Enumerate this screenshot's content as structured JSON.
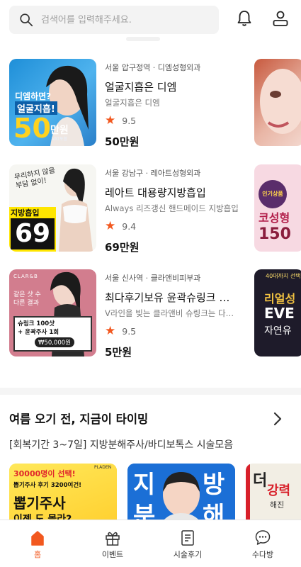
{
  "search": {
    "placeholder": "검색어를 입력해주세요."
  },
  "products": [
    {
      "location": "서울 압구정역 · 디엠성형외과",
      "title": "얼굴지흡은 디엠",
      "subtitle": "얼굴지흡은 디엠",
      "rating": "9.5",
      "price": "50만원",
      "thumb_text": {
        "line1": "디엠하면?",
        "line2": "얼굴지흡!",
        "big": "50",
        "unit": "만원",
        "vat": "VAT포함"
      }
    },
    {
      "location": "서울 강남구 · 레아트성형외과",
      "title": "레아트 대용량지방흡입",
      "subtitle": "Always 리즈갱신 핸드메이드 지방흡입",
      "rating": "9.4",
      "price": "69만원",
      "thumb_text": {
        "script": "무리하지 않을 부담 없이!",
        "label": "지방흡입",
        "big": "69"
      }
    },
    {
      "location": "서울 신사역 · 클라앤비피부과",
      "title": "최다후기보유 윤곽슈링크 …",
      "subtitle": "V라인을 빚는 클라앤비 슈링크는 다르…",
      "rating": "9.5",
      "price": "5만원",
      "thumb_text": {
        "brand": "CLAR&B",
        "q1": "같은 샷 수",
        "q2": "다른 결과",
        "box1": "슈링크 100샷",
        "box2": "+ 윤곽주사 1회",
        "box3": "₩50,000원"
      }
    }
  ],
  "peeks": [
    {
      "text": ""
    },
    {
      "badge": "인기상품",
      "text1": "코성형",
      "text2": "150"
    },
    {
      "top": "40대까지 선택!",
      "text1": "리얼성",
      "text2": "EVE",
      "text3": "자연유"
    }
  ],
  "section": {
    "title": "여름 오기 전, 지금이 타이밍",
    "subtitle": "[회복기간 3~7일] 지방분해주사/바디보톡스 시술모음"
  },
  "banners": [
    {
      "l1": "30000명이 선택!",
      "l2": "뽑기주사 후기 3200여건!",
      "l3": "뽑기주사",
      "l4": "이젠 도 몰라?",
      "brand": "PLADEN"
    },
    {
      "l1": "지",
      "l2": "방",
      "l3": "분",
      "l4": "해"
    },
    {
      "l1": "더",
      "l2": "강력",
      "l3": "해진"
    }
  ],
  "nav": [
    {
      "label": "홈",
      "active": true
    },
    {
      "label": "이벤트"
    },
    {
      "label": "시술후기"
    },
    {
      "label": "수다방"
    }
  ],
  "colors": {
    "accent": "#f2581f",
    "star": "#f2581f"
  }
}
